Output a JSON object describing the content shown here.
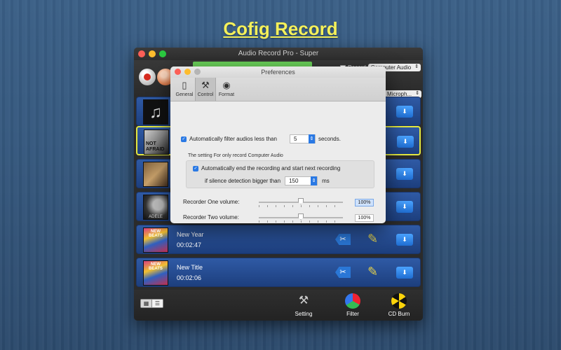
{
  "page": {
    "title": "Cofig Record"
  },
  "main_window": {
    "title": "Audio Record Pro - Super",
    "record_label": "Record",
    "record_source": "Computer Audio",
    "mic_source": "Microph..."
  },
  "recordings": [
    {
      "thumb": "music-icon",
      "title": "",
      "time": ""
    },
    {
      "thumb": "NOT AFRAID",
      "title": "",
      "time": ""
    },
    {
      "thumb": "",
      "title": "",
      "time": ""
    },
    {
      "thumb": "ADELE",
      "title": "",
      "time": ""
    },
    {
      "thumb": "NEW BEATS",
      "title": "New Year",
      "time": "00:02:47"
    },
    {
      "thumb": "NEW BEATS",
      "title": "New Title",
      "time": "00:02:06"
    }
  ],
  "bottom_toolbar": {
    "setting": "Setting",
    "filter": "Filter",
    "cd_burn": "CD Burn"
  },
  "preferences": {
    "title": "Preferences",
    "tabs": [
      {
        "label": "General",
        "icon": "switch-icon"
      },
      {
        "label": "Control",
        "icon": "tools-icon"
      },
      {
        "label": "Format",
        "icon": "format-icon"
      }
    ],
    "filter_label": "Automatically filter audios less than",
    "filter_value": "5",
    "filter_unit": "seconds.",
    "section_label": "The setting For only record Computer Audio",
    "auto_end_label": "Automatically  end the recording and start next recording",
    "silence_label": "if silence detection bigger than",
    "silence_value": "150",
    "silence_unit": "ms",
    "recorder_one_label": "Recorder One volume:",
    "recorder_one_value": "100%",
    "recorder_one_level": 0.5,
    "recorder_two_label": "Recorder Two volume:",
    "recorder_two_value": "100%",
    "recorder_two_level": 0.5
  }
}
